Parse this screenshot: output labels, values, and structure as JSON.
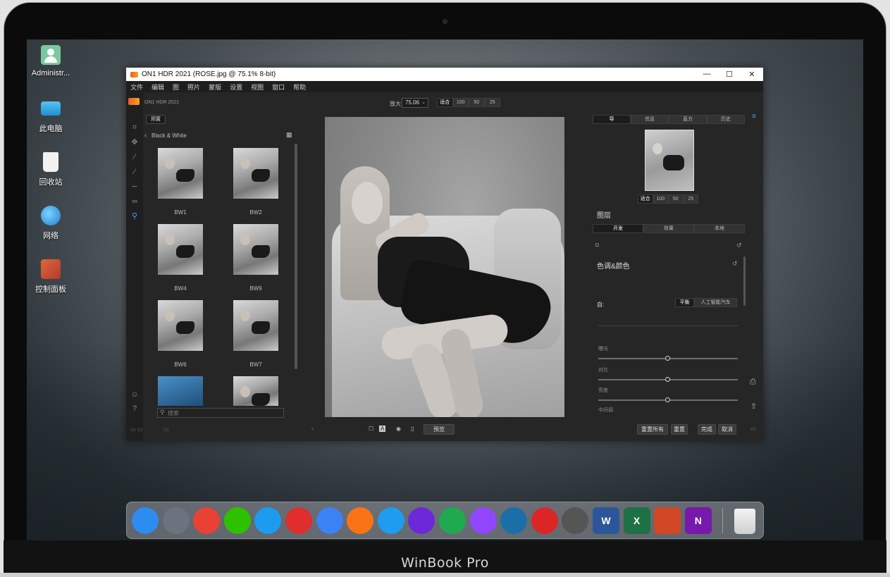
{
  "device": {
    "brand": "WinBook Pro"
  },
  "desktop": {
    "icons": [
      {
        "label": "Administr...",
        "icon": "user-icon"
      },
      {
        "label": "此电脑",
        "icon": "computer-icon"
      },
      {
        "label": "回收站",
        "icon": "recycle-bin-icon"
      },
      {
        "label": "网络",
        "icon": "network-icon"
      },
      {
        "label": "控制面板",
        "icon": "control-panel-icon"
      }
    ]
  },
  "window": {
    "title": "ON1 HDR 2021 (ROSE.jpg @ 75.1% 8-bit)",
    "controls": [
      "—",
      "☐",
      "✕"
    ],
    "menu": [
      "文件",
      "编辑",
      "图",
      "照片",
      "蒙版",
      "设置",
      "视图",
      "窗口",
      "帮助"
    ],
    "app_name": "ON1 HDR 2021"
  },
  "browser": {
    "tab": "预置",
    "category": "Black & White",
    "presets": [
      "BW1",
      "BW2",
      "BW4",
      "BW9",
      "BW6",
      "BW7"
    ],
    "search_placeholder": "搜索"
  },
  "viewer": {
    "zoom_label": "放大",
    "zoom_value": "75.06",
    "zoom_buttons": [
      "适合",
      "100",
      "50",
      "25"
    ],
    "preview_button": "预览"
  },
  "right_panel": {
    "tabs": [
      "导",
      "信息",
      "直方",
      "历史"
    ],
    "nav_buttons": [
      "适合",
      "100",
      "50",
      "25"
    ],
    "section_title": "图层",
    "mode_tabs": [
      "开发",
      "效果",
      "本地"
    ],
    "tone_section": "色调&颜色",
    "auto_label": "自:",
    "auto_buttons": [
      "平衡",
      "人工智能汽车"
    ],
    "sliders": [
      {
        "label": "曝光",
        "value": 0.5
      },
      {
        "label": "对比",
        "value": 0.5
      },
      {
        "label": "亮度",
        "value": 0.5
      },
      {
        "label": "中间调",
        "value": 0.5
      }
    ],
    "footer_buttons": [
      "重置所有",
      "重置",
      "完成",
      "取消"
    ]
  },
  "dock": {
    "apps": [
      {
        "name": "finder-icon",
        "color": "#2d8cf0",
        "glyph": ""
      },
      {
        "name": "launchpad-icon",
        "color": "#6b7280",
        "glyph": ""
      },
      {
        "name": "chrome-icon",
        "color": "#e94235",
        "glyph": ""
      },
      {
        "name": "wechat-icon",
        "color": "#2dc100",
        "glyph": ""
      },
      {
        "name": "qq-icon",
        "color": "#1d9bf0",
        "glyph": ""
      },
      {
        "name": "netease-music-icon",
        "color": "#e02d2d",
        "glyph": ""
      },
      {
        "name": "feishu-icon",
        "color": "#3b82f6",
        "glyph": ""
      },
      {
        "name": "vlc-icon",
        "color": "#f97316",
        "glyph": ""
      },
      {
        "name": "vscode-icon",
        "color": "#1f9cf0",
        "glyph": ""
      },
      {
        "name": "github-icon",
        "color": "#6d28d9",
        "glyph": ""
      },
      {
        "name": "evernote-icon",
        "color": "#1faa50",
        "glyph": ""
      },
      {
        "name": "twitch-icon",
        "color": "#9146ff",
        "glyph": ""
      },
      {
        "name": "steam-icon",
        "color": "#1b6fa8",
        "glyph": ""
      },
      {
        "name": "acrobat-icon",
        "color": "#dc2626",
        "glyph": ""
      },
      {
        "name": "inkscape-icon",
        "color": "#555555",
        "glyph": ""
      },
      {
        "name": "word-icon",
        "color": "#2b579a",
        "glyph": "W"
      },
      {
        "name": "excel-icon",
        "color": "#1e7145",
        "glyph": "X"
      },
      {
        "name": "powerpoint-icon",
        "color": "#d24726",
        "glyph": ""
      },
      {
        "name": "onenote-icon",
        "color": "#7719aa",
        "glyph": "N"
      }
    ],
    "trash": "trash-icon"
  }
}
